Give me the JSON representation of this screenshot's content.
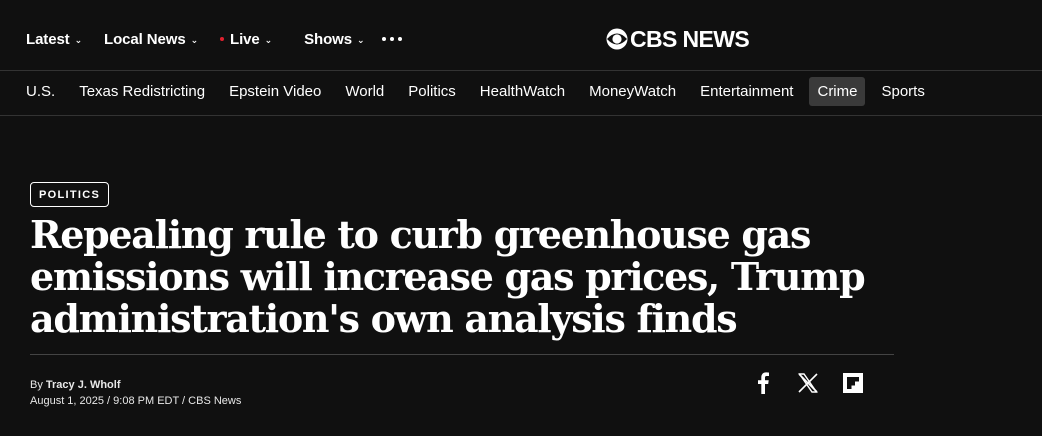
{
  "topnav": {
    "items": [
      {
        "label": "Latest"
      },
      {
        "label": "Local News"
      },
      {
        "label": "Live"
      },
      {
        "label": "Shows"
      }
    ]
  },
  "logo": {
    "text": "CBS NEWS"
  },
  "sections": [
    "U.S.",
    "Texas Redistricting",
    "Epstein Video",
    "World",
    "Politics",
    "HealthWatch",
    "MoneyWatch",
    "Entertainment",
    "Crime",
    "Sports"
  ],
  "active_section": "Crime",
  "article": {
    "category": "POLITICS",
    "headline": "Repealing rule to curb greenhouse gas emissions will increase gas prices, Trump administration's own analysis finds",
    "by_prefix": "By",
    "author": "Tracy J. Wholf",
    "dateline": "August 1, 2025 / 9:08 PM EDT / CBS News"
  },
  "share": [
    {
      "icon": "facebook-icon"
    },
    {
      "icon": "x-icon"
    },
    {
      "icon": "flipboard-icon"
    }
  ],
  "colors": {
    "background": "#101010",
    "live_dot": "#e0202e",
    "active_tab": "#3a3a3a"
  }
}
